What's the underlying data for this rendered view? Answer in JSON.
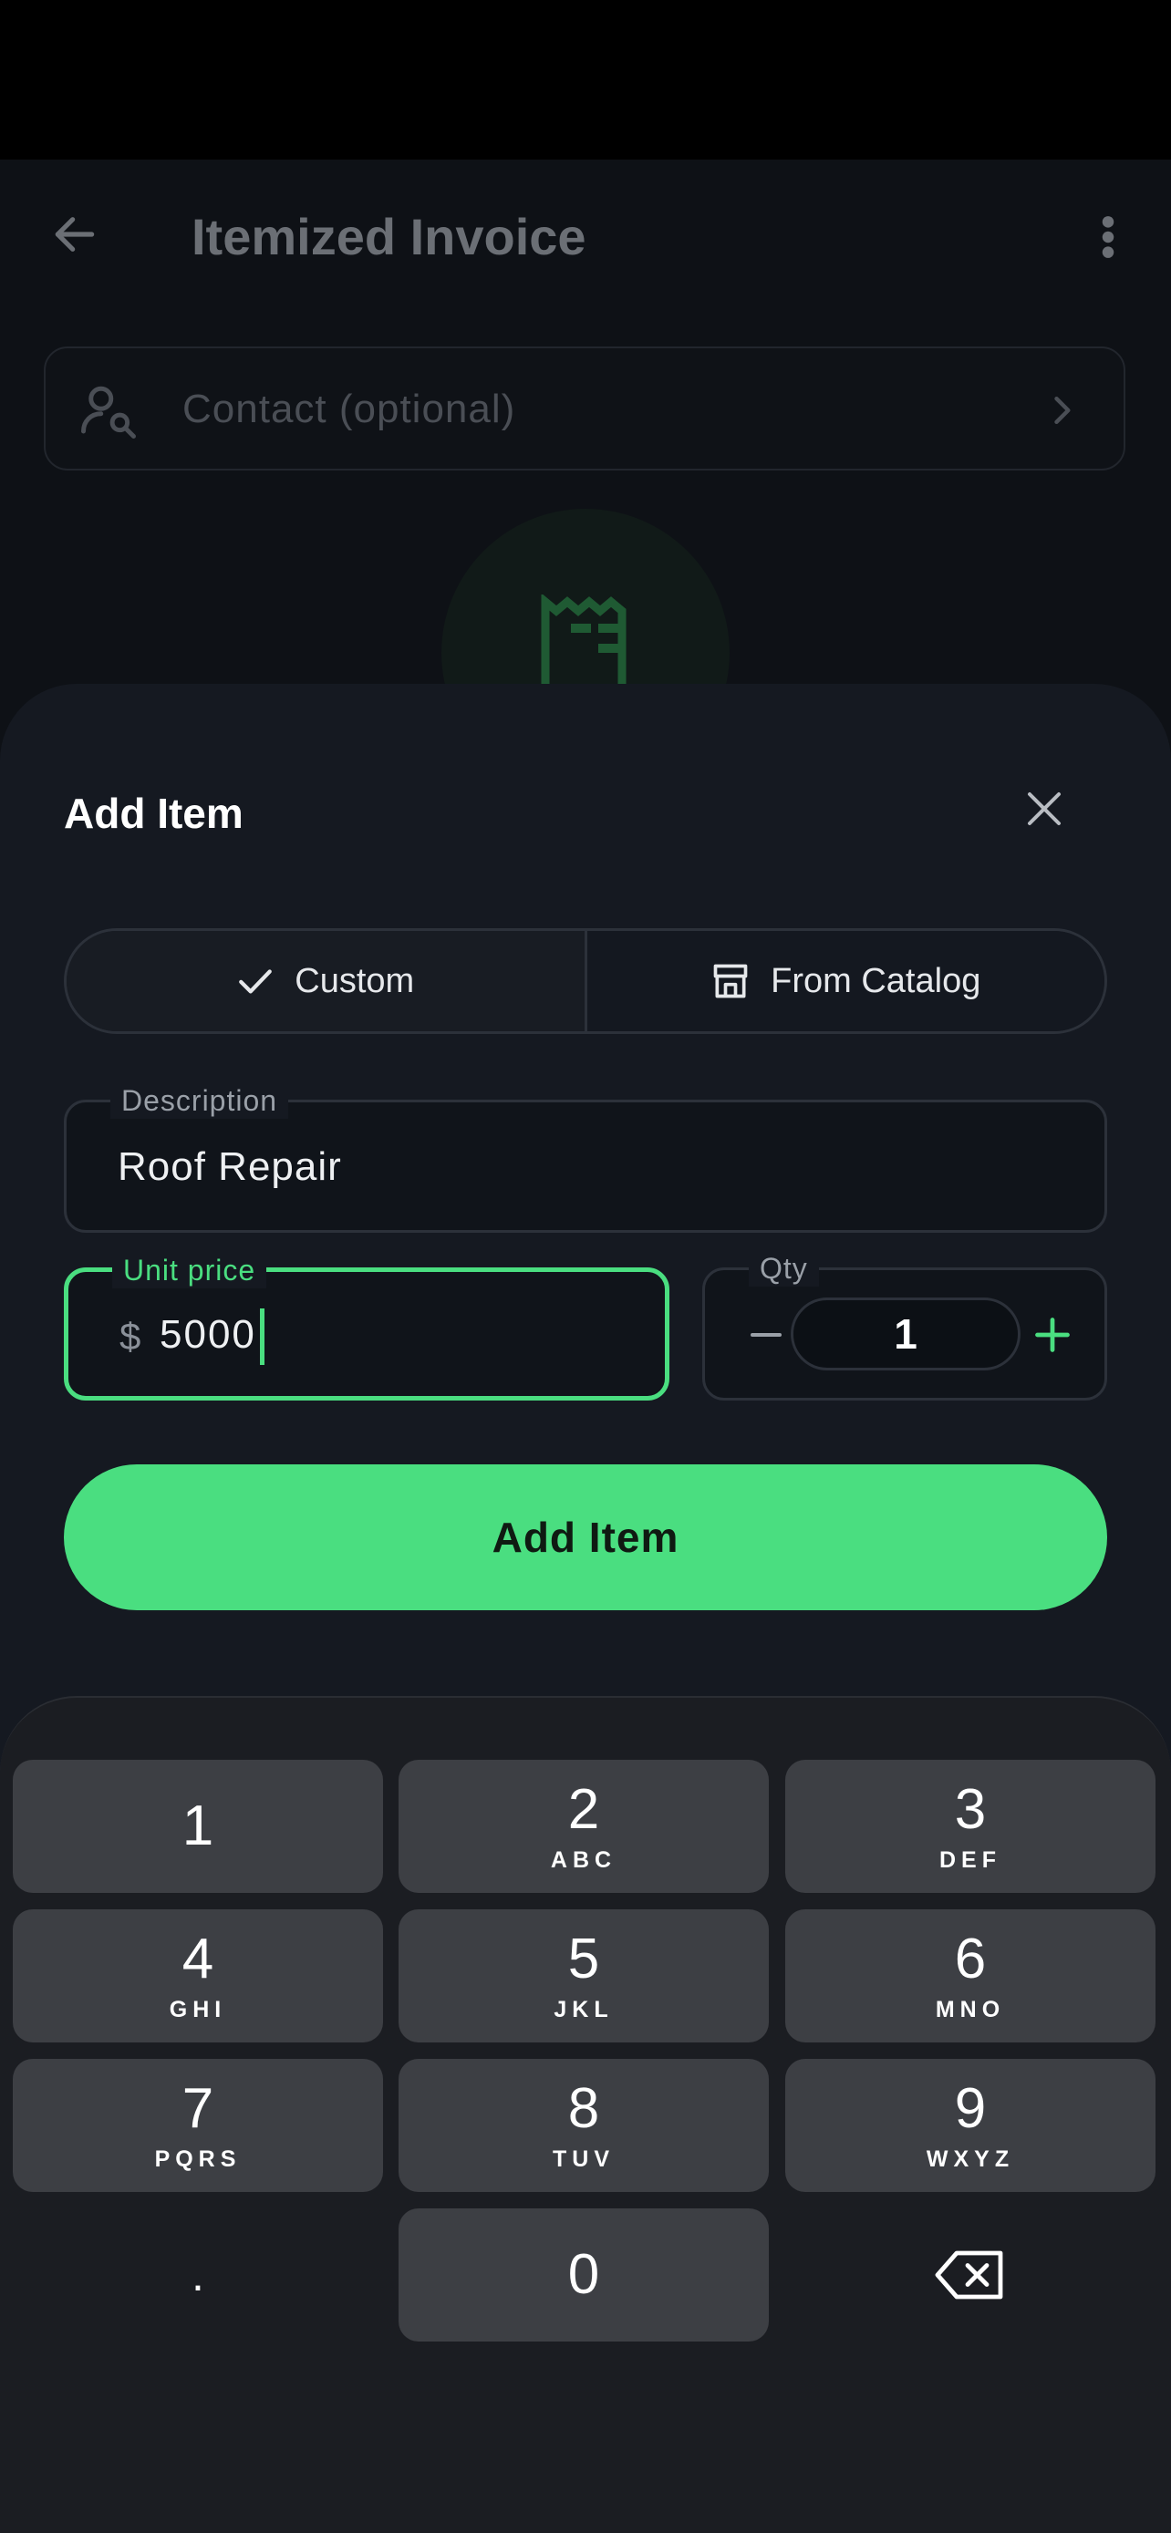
{
  "header": {
    "title": "Itemized Invoice"
  },
  "contact": {
    "placeholder": "Contact (optional)"
  },
  "sheet": {
    "title": "Add Item",
    "segments": {
      "custom": "Custom",
      "catalog": "From Catalog"
    },
    "description": {
      "label": "Description",
      "value": "Roof Repair"
    },
    "unit_price": {
      "label": "Unit price",
      "currency": "$",
      "value": "5000"
    },
    "qty": {
      "label": "Qty",
      "value": "1"
    },
    "add_button": "Add Item"
  },
  "keypad": {
    "k1": {
      "num": "1",
      "letters": ""
    },
    "k2": {
      "num": "2",
      "letters": "ABC"
    },
    "k3": {
      "num": "3",
      "letters": "DEF"
    },
    "k4": {
      "num": "4",
      "letters": "GHI"
    },
    "k5": {
      "num": "5",
      "letters": "JKL"
    },
    "k6": {
      "num": "6",
      "letters": "MNO"
    },
    "k7": {
      "num": "7",
      "letters": "PQRS"
    },
    "k8": {
      "num": "8",
      "letters": "TUV"
    },
    "k9": {
      "num": "9",
      "letters": "WXYZ"
    },
    "k0": {
      "num": "0",
      "letters": ""
    },
    "kdot": {
      "num": "."
    }
  },
  "colors": {
    "accent": "#4ade80",
    "sheet_bg": "#151921",
    "key_bg": "#3d3f44"
  }
}
